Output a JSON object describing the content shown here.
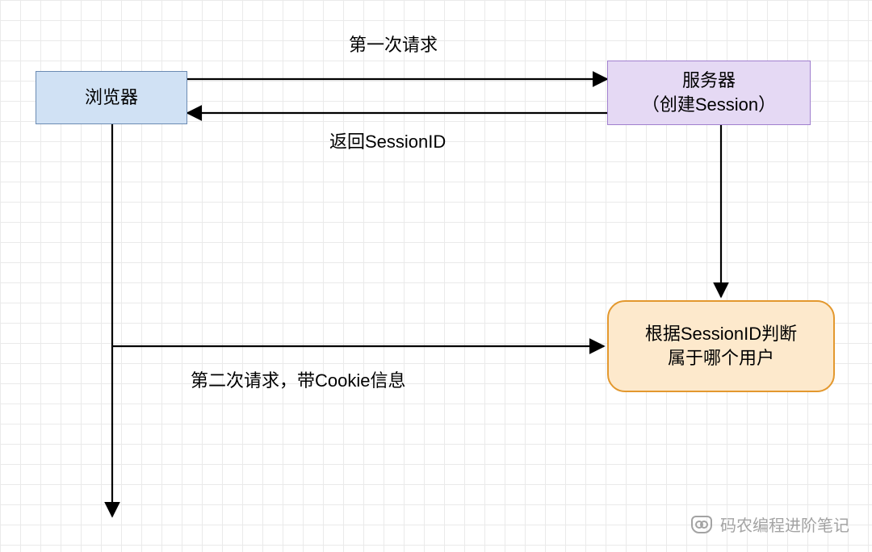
{
  "nodes": {
    "browser": "浏览器",
    "server": "服务器\n（创建Session）",
    "judge": "根据SessionID判断\n属于哪个用户"
  },
  "edges": {
    "first_request": "第一次请求",
    "return_session_id": "返回SessionID",
    "second_request": "第二次请求，带Cookie信息"
  },
  "watermark": "码农编程进阶笔记"
}
